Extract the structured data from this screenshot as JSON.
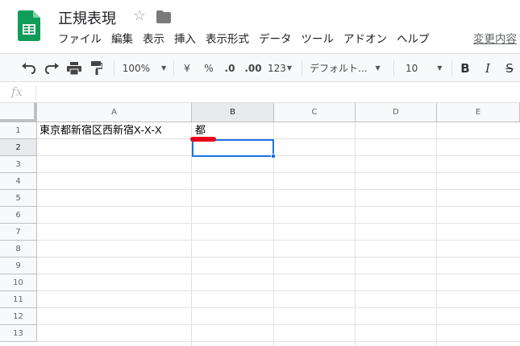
{
  "doc": {
    "title": "正規表現",
    "star_icon": "star-icon",
    "folder_icon": "folder-icon"
  },
  "menu": {
    "items": [
      "ファイル",
      "編集",
      "表示",
      "挿入",
      "表示形式",
      "データ",
      "ツール",
      "アドオン",
      "ヘルプ"
    ],
    "last_edit_link": "変更内容"
  },
  "toolbar": {
    "undo_icon": "undo-icon",
    "redo_icon": "redo-icon",
    "print_icon": "print-icon",
    "paint_format_icon": "paint-format-icon",
    "zoom": "100%",
    "currency": "¥",
    "percent": "%",
    "decrease_decimal": ".0",
    "increase_decimal": ".00",
    "more_formats": "123",
    "font": "デフォルト...",
    "font_size": "10",
    "bold": "B",
    "italic": "I",
    "strikethrough": "S"
  },
  "formula_bar": {
    "fx_label": "fx",
    "value": ""
  },
  "sheet": {
    "columns": [
      "A",
      "B",
      "C",
      "D",
      "E"
    ],
    "rows": [
      "1",
      "2",
      "3",
      "4",
      "5",
      "6",
      "7",
      "8",
      "9",
      "10",
      "11",
      "12",
      "13"
    ],
    "cells": {
      "A1": "東京都新宿区西新宿X-X-X",
      "B1": "都"
    },
    "selected_cell": "B2"
  },
  "colors": {
    "selection": "#1a73e8",
    "annotation": "#e8001c",
    "sheets_green": "#0f9d58"
  }
}
